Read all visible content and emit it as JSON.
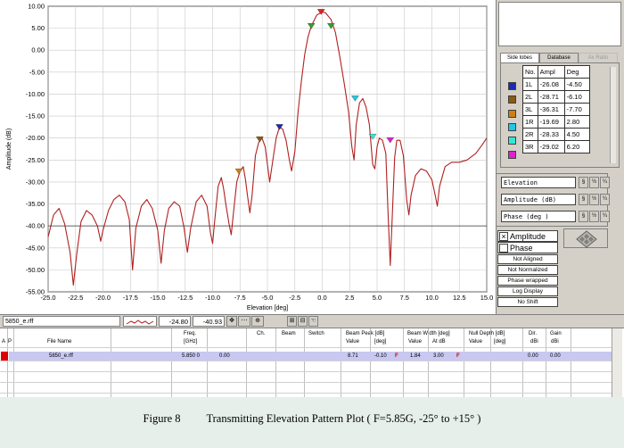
{
  "chart_data": {
    "type": "line",
    "xlabel": "Elevation  [deg]",
    "ylabel": "Amplitude (dB)",
    "xlim": [
      -25,
      15
    ],
    "ylim": [
      -55,
      10
    ],
    "x_ticks": [
      "-25.0",
      "-22.5",
      "-20.0",
      "-17.5",
      "-15.0",
      "-12.5",
      "-10.0",
      "-7.5",
      "-5.0",
      "-2.5",
      "0.0",
      "2.5",
      "5.0",
      "7.5",
      "10.0",
      "12.5",
      "15.0"
    ],
    "y_ticks": [
      "10.00",
      "5.00",
      "0.00",
      "-5.00",
      "-10.00",
      "-15.00",
      "-20.00",
      "-25.00",
      "-30.00",
      "-35.00",
      "-40.00",
      "-45.00",
      "-50.00",
      "-55.00"
    ],
    "reference_level": -40,
    "series": [
      {
        "color": "#b02020",
        "points": [
          [
            -25.0,
            -42.5
          ],
          [
            -24.5,
            -37.5
          ],
          [
            -24.0,
            -36.0
          ],
          [
            -23.5,
            -39.5
          ],
          [
            -23.0,
            -46.0
          ],
          [
            -22.7,
            -53.5
          ],
          [
            -22.4,
            -46.5
          ],
          [
            -22.0,
            -39.0
          ],
          [
            -21.5,
            -36.5
          ],
          [
            -21.0,
            -37.5
          ],
          [
            -20.5,
            -40.0
          ],
          [
            -20.2,
            -43.5
          ],
          [
            -20.0,
            -41.0
          ],
          [
            -19.5,
            -36.5
          ],
          [
            -19.0,
            -34.0
          ],
          [
            -18.5,
            -33.0
          ],
          [
            -18.0,
            -34.5
          ],
          [
            -17.6,
            -38.5
          ],
          [
            -17.3,
            -50.0
          ],
          [
            -17.0,
            -40.5
          ],
          [
            -16.5,
            -35.5
          ],
          [
            -16.0,
            -34.0
          ],
          [
            -15.5,
            -36.0
          ],
          [
            -15.0,
            -41.0
          ],
          [
            -14.7,
            -48.5
          ],
          [
            -14.4,
            -41.0
          ],
          [
            -14.0,
            -36.0
          ],
          [
            -13.5,
            -34.5
          ],
          [
            -13.0,
            -35.5
          ],
          [
            -12.6,
            -40.5
          ],
          [
            -12.3,
            -46.0
          ],
          [
            -12.0,
            -40.5
          ],
          [
            -11.5,
            -34.5
          ],
          [
            -11.0,
            -33.0
          ],
          [
            -10.5,
            -35.5
          ],
          [
            -10.2,
            -41.5
          ],
          [
            -10.0,
            -44.0
          ],
          [
            -9.8,
            -38.5
          ],
          [
            -9.5,
            -31.0
          ],
          [
            -9.2,
            -29.0
          ],
          [
            -9.0,
            -31.5
          ],
          [
            -8.8,
            -35.0
          ],
          [
            -8.5,
            -39.5
          ],
          [
            -8.3,
            -42.0
          ],
          [
            -8.1,
            -37.0
          ],
          [
            -7.8,
            -30.0
          ],
          [
            -7.5,
            -27.5
          ],
          [
            -7.2,
            -26.5
          ],
          [
            -7.0,
            -29.5
          ],
          [
            -6.8,
            -33.5
          ],
          [
            -6.6,
            -37.0
          ],
          [
            -6.4,
            -33.0
          ],
          [
            -6.1,
            -24.0
          ],
          [
            -5.8,
            -21.0
          ],
          [
            -5.5,
            -20.0
          ],
          [
            -5.2,
            -22.0
          ],
          [
            -5.0,
            -26.0
          ],
          [
            -4.8,
            -30.0
          ],
          [
            -4.5,
            -25.0
          ],
          [
            -4.2,
            -20.0
          ],
          [
            -3.9,
            -17.5
          ],
          [
            -3.6,
            -18.0
          ],
          [
            -3.3,
            -20.5
          ],
          [
            -3.0,
            -25.0
          ],
          [
            -2.8,
            -27.5
          ],
          [
            -2.5,
            -23.0
          ],
          [
            -2.2,
            -14.0
          ],
          [
            -1.9,
            -7.0
          ],
          [
            -1.6,
            -1.0
          ],
          [
            -1.3,
            3.0
          ],
          [
            -1.0,
            5.5
          ],
          [
            -0.5,
            8.0
          ],
          [
            0.0,
            8.7
          ],
          [
            0.3,
            8.5
          ],
          [
            0.8,
            7.0
          ],
          [
            1.2,
            4.0
          ],
          [
            1.6,
            -1.5
          ],
          [
            2.0,
            -7.5
          ],
          [
            2.4,
            -14.0
          ],
          [
            2.7,
            -22.0
          ],
          [
            2.9,
            -25.0
          ],
          [
            3.1,
            -17.0
          ],
          [
            3.4,
            -12.0
          ],
          [
            3.7,
            -11.0
          ],
          [
            4.0,
            -13.0
          ],
          [
            4.3,
            -17.0
          ],
          [
            4.6,
            -26.0
          ],
          [
            4.8,
            -27.0
          ],
          [
            5.0,
            -22.0
          ],
          [
            5.2,
            -20.0
          ],
          [
            5.5,
            -20.5
          ],
          [
            5.8,
            -23.5
          ],
          [
            6.0,
            -37.0
          ],
          [
            6.2,
            -49.0
          ],
          [
            6.4,
            -37.0
          ],
          [
            6.6,
            -24.5
          ],
          [
            6.8,
            -20.5
          ],
          [
            7.1,
            -20.5
          ],
          [
            7.4,
            -24.0
          ],
          [
            7.7,
            -34.0
          ],
          [
            7.9,
            -37.5
          ],
          [
            8.1,
            -33.0
          ],
          [
            8.5,
            -28.5
          ],
          [
            9.0,
            -27.0
          ],
          [
            9.5,
            -27.5
          ],
          [
            10.0,
            -29.5
          ],
          [
            10.3,
            -33.0
          ],
          [
            10.5,
            -35.5
          ],
          [
            10.7,
            -31.0
          ],
          [
            11.2,
            -26.5
          ],
          [
            11.8,
            -25.5
          ],
          [
            12.5,
            -25.5
          ],
          [
            13.2,
            -25.0
          ],
          [
            14.0,
            -23.5
          ],
          [
            14.6,
            -21.5
          ],
          [
            15.0,
            -20.0
          ]
        ]
      }
    ],
    "markers": [
      {
        "label": "1L",
        "deg": -4.5,
        "ampl": -26.08,
        "color": "#1a2ab0",
        "plot_x": -3.9,
        "plot_y": -17.5
      },
      {
        "label": "2L",
        "deg": -6.1,
        "ampl": -28.71,
        "color": "#8a5a10",
        "plot_x": -5.7,
        "plot_y": -20.3
      },
      {
        "label": "3L",
        "deg": -7.7,
        "ampl": -36.31,
        "color": "#d08010",
        "plot_x": -7.6,
        "plot_y": -27.6
      },
      {
        "label": "1R",
        "deg": 2.8,
        "ampl": -19.69,
        "color": "#20c8e8",
        "plot_x": 3.0,
        "plot_y": -11.0
      },
      {
        "label": "2R",
        "deg": 4.5,
        "ampl": -28.33,
        "color": "#30e8d8",
        "plot_x": 4.6,
        "plot_y": -19.7
      },
      {
        "label": "3R",
        "deg": 6.2,
        "ampl": -29.02,
        "color": "#e020d0",
        "plot_x": 6.2,
        "plot_y": -20.5
      },
      {
        "label": "peak-left",
        "color": "#30a030",
        "plot_x": -1.0,
        "plot_y": 5.5
      },
      {
        "label": "peak",
        "color": "#e02020",
        "plot_x": -0.1,
        "plot_y": 8.7
      },
      {
        "label": "peak-right",
        "color": "#30a030",
        "plot_x": 0.8,
        "plot_y": 5.5
      }
    ]
  },
  "right_panel": {
    "tabs": [
      "Side lobes",
      "Database",
      "Ax Ratio"
    ],
    "lobe_table": {
      "headers": [
        "No.",
        "Ampl",
        "Deg"
      ],
      "rows": [
        {
          "no": "1L",
          "ampl": "-26.08",
          "deg": "-4.50",
          "color": "#1a2ab0"
        },
        {
          "no": "2L",
          "ampl": "-28.71",
          "deg": "-6.10",
          "color": "#8a5a10"
        },
        {
          "no": "3L",
          "ampl": "-36.31",
          "deg": "-7.70",
          "color": "#d08010"
        },
        {
          "no": "1R",
          "ampl": "-19.69",
          "deg": "2.80",
          "color": "#20c8e8"
        },
        {
          "no": "2R",
          "ampl": "-28.33",
          "deg": "4.50",
          "color": "#30e8d8"
        },
        {
          "no": "3R",
          "ampl": "-29.02",
          "deg": "6.20",
          "color": "#e020d0"
        }
      ]
    },
    "axis_selectors": [
      {
        "label": "Elevation"
      },
      {
        "label": "Amplitude (dB)"
      },
      {
        "label": "Phase (deg )"
      }
    ],
    "checkbox_amplitude": "Amplitude",
    "checkbox_phase": "Phase",
    "options": [
      "Not Aligned",
      "Not Normalized",
      "Phase wrapped",
      "Log Display",
      "No Shift"
    ]
  },
  "control_bar": {
    "file": "5850_e.rff",
    "x_value": "-24.80",
    "y_value": "-40.93"
  },
  "grid": {
    "headers": {
      "a": "A",
      "p": "P",
      "file_name": "File Name",
      "freq": "Freq.",
      "freq_unit": "[GHz]",
      "ch": "Ch.",
      "beam": "Beam",
      "switch": "Switch",
      "beam_peak": "Beam Peak [dB]",
      "bp_value": "Value",
      "bp_deg": "[deg]",
      "beam_width": "Beam Width [deg]",
      "bw_value": "Value",
      "bw_at": "At dB",
      "null_depth": "Null Depth [dB]",
      "nd_value": "Value",
      "nd_deg": "[deg]",
      "dir": "Dir.",
      "dir_unit": "dBi",
      "gain": "Gain",
      "gain_unit": "dBi"
    },
    "row": {
      "file": "5850_e.rff",
      "freq": "5.850 0",
      "ch": "0.00",
      "bp_value": "8.71",
      "bp_deg": "-0.10",
      "flag1": "F",
      "bw_value": "1.84",
      "bw_at": "3.00",
      "flag2": "F",
      "dir": "0.00",
      "gain": "0.00"
    }
  },
  "caption": {
    "figure": "Figure 8",
    "text": "Transmitting Elevation Pattern Plot ( F=5.85G, -25° to +15° )"
  }
}
